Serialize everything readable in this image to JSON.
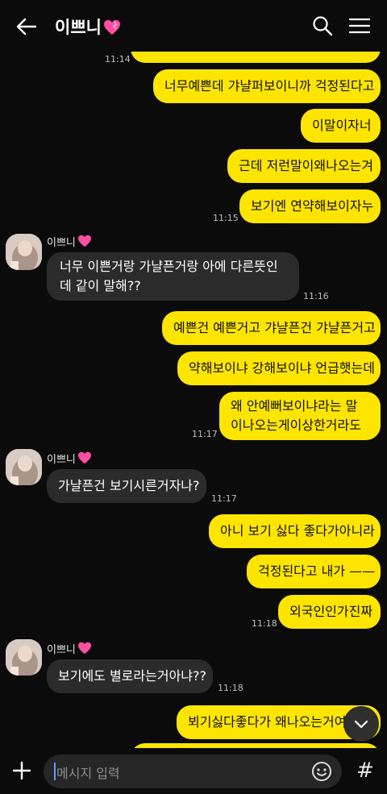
{
  "header": {
    "title": "이쁘니",
    "title_emoji": "💖"
  },
  "input": {
    "placeholder": "메시지 입력"
  },
  "buttons": {
    "hash": "#"
  },
  "contact": {
    "name": "이쁘니"
  },
  "messages": [
    {
      "text": "너무예쁜데 갸냘퍼보이니까 걱정된다고",
      "time": "11:14"
    },
    {
      "text": "이말이자너"
    },
    {
      "text": "근데 저런말이왜나오는겨"
    },
    {
      "text": "보기엔 연약해보이자누",
      "time": "11:15"
    },
    {
      "text": "너무 이쁜거랑 가냘픈거랑 아에 다른뜻인데 같이 말해??",
      "time": "11:16"
    },
    {
      "text": "예쁜건 예쁜거고 갸냘픈건 갸냘픈거고"
    },
    {
      "text": "약해보이냐 강해보이냐 언급햇는데"
    },
    {
      "text": "왜 안예뻐보이냐라는 말이나오는게이상한거라도",
      "time": "11:17"
    },
    {
      "text": "가냘픈건 보기시른거자나?",
      "time": "11:17"
    },
    {
      "text": "아니 보기 싫다 좋다가아니라"
    },
    {
      "text": "걱정된다고 내가 ——"
    },
    {
      "text": "외국인인가진짜",
      "time": "11:18"
    },
    {
      "text": "보기에도 별로라는거아냐??",
      "time": "11:18"
    },
    {
      "text": "뵈기싫다좋다가 왜나오는거여"
    }
  ]
}
